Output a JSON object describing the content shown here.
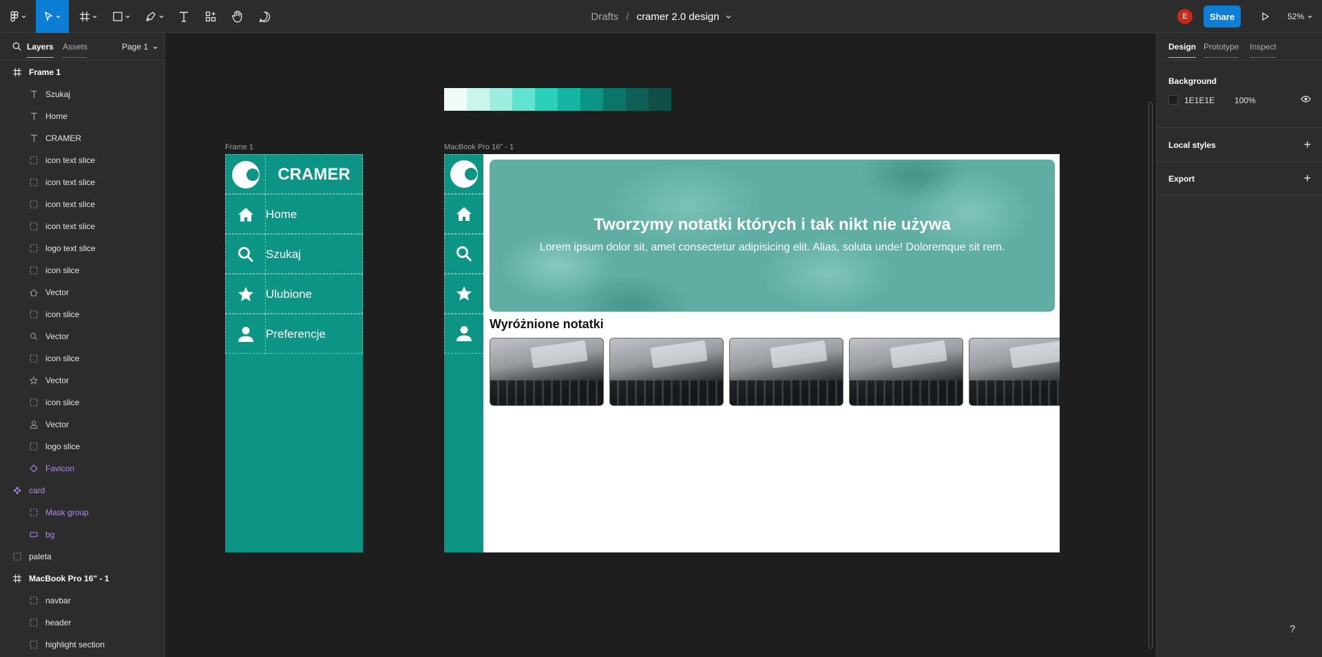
{
  "toolbar": {
    "breadcrumb_project": "Drafts",
    "breadcrumb_separator": "/",
    "file_name": "cramer 2.0 design",
    "avatar_initial": "E",
    "share_label": "Share",
    "zoom": "52%"
  },
  "left_panel": {
    "tabs": [
      "Layers",
      "Assets"
    ],
    "page": "Page 1",
    "layers": [
      {
        "name": "Frame 1",
        "icon": "frame-icon",
        "level": 0,
        "style": "bold"
      },
      {
        "name": "Szukaj",
        "icon": "text-icon",
        "level": 1
      },
      {
        "name": "Home",
        "icon": "text-icon",
        "level": 1
      },
      {
        "name": "CRAMER",
        "icon": "text-icon",
        "level": 1
      },
      {
        "name": "icon text slice",
        "icon": "slice-icon",
        "level": 1
      },
      {
        "name": "icon text slice",
        "icon": "slice-icon",
        "level": 1
      },
      {
        "name": "icon text slice",
        "icon": "slice-icon",
        "level": 1
      },
      {
        "name": "icon text slice",
        "icon": "slice-icon",
        "level": 1
      },
      {
        "name": "logo text slice",
        "icon": "slice-icon",
        "level": 1
      },
      {
        "name": "icon slice",
        "icon": "slice-icon",
        "level": 1
      },
      {
        "name": "Vector",
        "icon": "home-vector-icon",
        "level": 1
      },
      {
        "name": "icon slice",
        "icon": "slice-icon",
        "level": 1
      },
      {
        "name": "Vector",
        "icon": "search-vector-icon",
        "level": 1
      },
      {
        "name": "icon slice",
        "icon": "slice-icon",
        "level": 1
      },
      {
        "name": "Vector",
        "icon": "star-vector-icon",
        "level": 1
      },
      {
        "name": "icon slice",
        "icon": "slice-icon",
        "level": 1
      },
      {
        "name": "Vector",
        "icon": "person-vector-icon",
        "level": 1
      },
      {
        "name": "logo slice",
        "icon": "slice-icon",
        "level": 1
      },
      {
        "name": "Favicon",
        "icon": "instance-icon",
        "level": 1,
        "style": "purple"
      },
      {
        "name": "card",
        "icon": "component-icon",
        "level": 0,
        "style": "purple"
      },
      {
        "name": "Mask group",
        "icon": "slice-icon",
        "level": 1,
        "style": "purple"
      },
      {
        "name": "bg",
        "icon": "rectangle-icon",
        "level": 1,
        "style": "purple"
      },
      {
        "name": "paleta",
        "icon": "slice-icon",
        "level": 0
      },
      {
        "name": "MacBook Pro 16\" - 1",
        "icon": "frame-icon",
        "level": 0,
        "style": "bold"
      },
      {
        "name": "navbar",
        "icon": "slice-icon",
        "level": 1
      },
      {
        "name": "header",
        "icon": "slice-icon",
        "level": 1
      },
      {
        "name": "highlight section",
        "icon": "slice-icon",
        "level": 1
      }
    ]
  },
  "right_panel": {
    "tabs": [
      "Design",
      "Prototype",
      "Inspect"
    ],
    "background_title": "Background",
    "background_hex": "1E1E1E",
    "background_opacity": "100%",
    "local_styles_title": "Local styles",
    "export_title": "Export",
    "help": "?"
  },
  "canvas": {
    "palette_colors": [
      "#effcf8",
      "#c9f5ec",
      "#9eeee0",
      "#62e3cf",
      "#2bd0bb",
      "#14b5a2",
      "#0c9485",
      "#0d766b",
      "#0f5f57",
      "#104e48"
    ],
    "frame1": {
      "label": "Frame 1",
      "logo_text": "CRAMER",
      "nav": [
        {
          "label": "Home",
          "icon": "home-icon"
        },
        {
          "label": "Szukaj",
          "icon": "search-icon"
        },
        {
          "label": "Ulubione",
          "icon": "star-icon"
        },
        {
          "label": "Preferencje",
          "icon": "person-icon"
        }
      ]
    },
    "macbook": {
      "label": "MacBook Pro 16\" - 1",
      "hero_title": "Tworzymy notatki których i tak nikt nie używa",
      "hero_subtitle": "Lorem ipsum dolor sit, amet consectetur adipisicing elit. Alias, soluta unde! Doloremque sit rem.",
      "section_title": "Wyróżnione notatki",
      "card_count": 5
    }
  },
  "colors": {
    "accent": "#0d7ed6",
    "brand_teal": "#0c9485",
    "canvas_bg": "#1e1e1e",
    "panel_bg": "#2c2c2c",
    "component_purple": "#b28af7"
  }
}
